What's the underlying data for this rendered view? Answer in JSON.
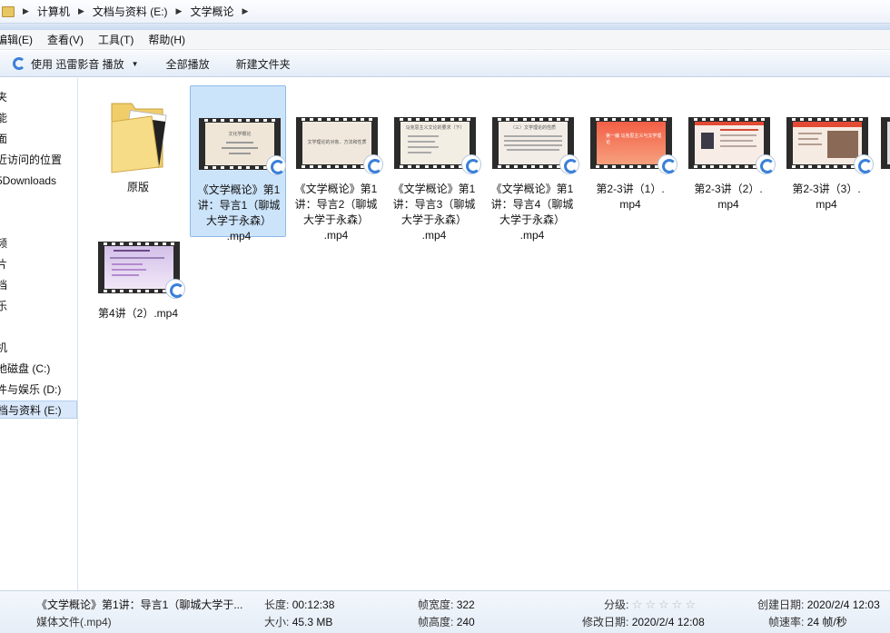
{
  "address": {
    "crumbs": [
      "计算机",
      "文档与资料 (E:)",
      "文学概论"
    ]
  },
  "menubar": {
    "items": [
      "编辑(E)",
      "查看(V)",
      "工具(T)",
      "帮助(H)"
    ]
  },
  "toolbar": {
    "play_with": "使用 迅雷影音 播放",
    "play_all": "全部播放",
    "new_folder": "新建文件夹"
  },
  "nav": {
    "items": [
      "夹",
      "能",
      "面",
      "近访问的位置",
      "5Downloads",
      "频",
      "片",
      "档",
      "乐",
      "机",
      "地磁盘 (C:)",
      "件与娱乐 (D:)",
      "档与资料 (E:)"
    ]
  },
  "files": [
    {
      "name": "原版",
      "type": "folder"
    },
    {
      "name": "《文学概论》第1讲：导言1（聊城大学于永森）.mp4",
      "lines": [
        "《文学概论》第1",
        "讲：导言1（聊城",
        "大学于永森）",
        ".mp4"
      ],
      "thumb_text": "文化学概论",
      "thumb_bg": "#efe6d8"
    },
    {
      "name": "《文学概论》第1讲：导言2（聊城大学于永森）.mp4",
      "lines": [
        "《文学概论》第1",
        "讲：导言2（聊城",
        "大学于永森）",
        ".mp4"
      ],
      "thumb_text": "文学理论的对象、方法和性质",
      "thumb_bg": "#f0e8dc"
    },
    {
      "name": "《文学概论》第1讲：导言3（聊城大学于永森）.mp4",
      "lines": [
        "《文学概论》第1",
        "讲：导言3（聊城",
        "大学于永森）",
        ".mp4"
      ],
      "thumb_text": "马克思主义文论的要求（下）",
      "thumb_bg": "#f3eee4"
    },
    {
      "name": "《文学概论》第1讲：导言4（聊城大学于永森）.mp4",
      "lines": [
        "《文学概论》第1",
        "讲：导言4（聊城",
        "大学于永森）",
        ".mp4"
      ],
      "thumb_text": "（三）文学理论的性质",
      "thumb_bg": "#f2ede6"
    },
    {
      "name": "第2-3讲（1）.mp4",
      "lines": [
        "第2-3讲（1）.",
        "mp4"
      ],
      "thumb_text": "第一编 马克思主义与文学理论",
      "thumb_bg": "#f36d52"
    },
    {
      "name": "第2-3讲（2）.mp4",
      "lines": [
        "第2-3讲（2）.",
        "mp4"
      ],
      "thumb_text": "",
      "thumb_bg": "#f7ece6"
    },
    {
      "name": "第2-3讲（3）.mp4",
      "lines": [
        "第2-3讲（3）.",
        "mp4"
      ],
      "thumb_text": "",
      "thumb_bg": "#f6ebe2"
    },
    {
      "name": "第4讲（2）.mp4",
      "lines": [
        "第4讲（2）.mp4"
      ],
      "thumb_text": "",
      "thumb_bg": "#e8d6f0"
    }
  ],
  "details": {
    "filename": "《文学概论》第1讲：导言1（聊城大学于...",
    "filetype": "媒体文件(.mp4)",
    "length_label": "长度:",
    "length_value": "00:12:38",
    "size_label": "大小:",
    "size_value": "45.3 MB",
    "frame_width_label": "帧宽度:",
    "frame_width_value": "322",
    "frame_height_label": "帧高度:",
    "frame_height_value": "240",
    "rating_label": "分级:",
    "rating_value": 0,
    "modified_label": "修改日期:",
    "modified_value": "2020/2/4 12:08",
    "created_label": "创建日期:",
    "created_value": "2020/2/4 12:03",
    "framerate_label": "帧速率:",
    "framerate_value": "24 帧/秒"
  }
}
